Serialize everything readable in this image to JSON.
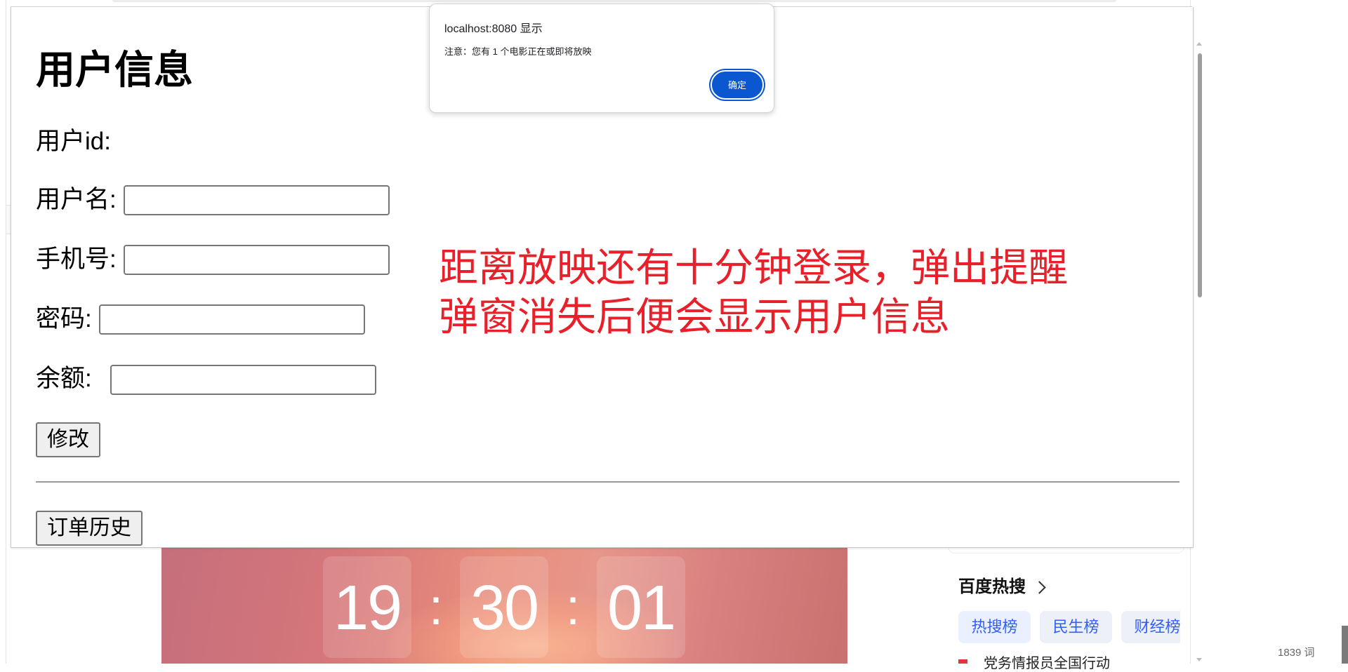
{
  "user_info": {
    "title": "用户信息",
    "labels": {
      "user_id": "用户id:",
      "username": "用户名:",
      "phone": "手机号:",
      "password": "密码:",
      "balance": "余额:"
    },
    "values": {
      "username": "",
      "phone": "",
      "password": "",
      "balance": ""
    },
    "edit_button": "修改",
    "order_history_button": "订单历史"
  },
  "annotation": {
    "line1": "距离放映还有十分钟登录，弹出提醒",
    "line2": "弹窗消失后便会显示用户信息",
    "color": "#e8202a"
  },
  "alert": {
    "title": "localhost:8080 显示",
    "message": "注意：您有 1 个电影正在或即将放映",
    "ok_label": "确定",
    "accent": "#0b57d0"
  },
  "background": {
    "clock": {
      "hours": "19",
      "minutes": "30",
      "seconds": "01",
      "separator": ":"
    },
    "hot_search": {
      "title": "百度热搜",
      "tabs": [
        "热搜榜",
        "民生榜",
        "财经榜"
      ],
      "active_tab": 0,
      "first_item": "党务情报员全国行动"
    },
    "word_count": "1839 词"
  }
}
